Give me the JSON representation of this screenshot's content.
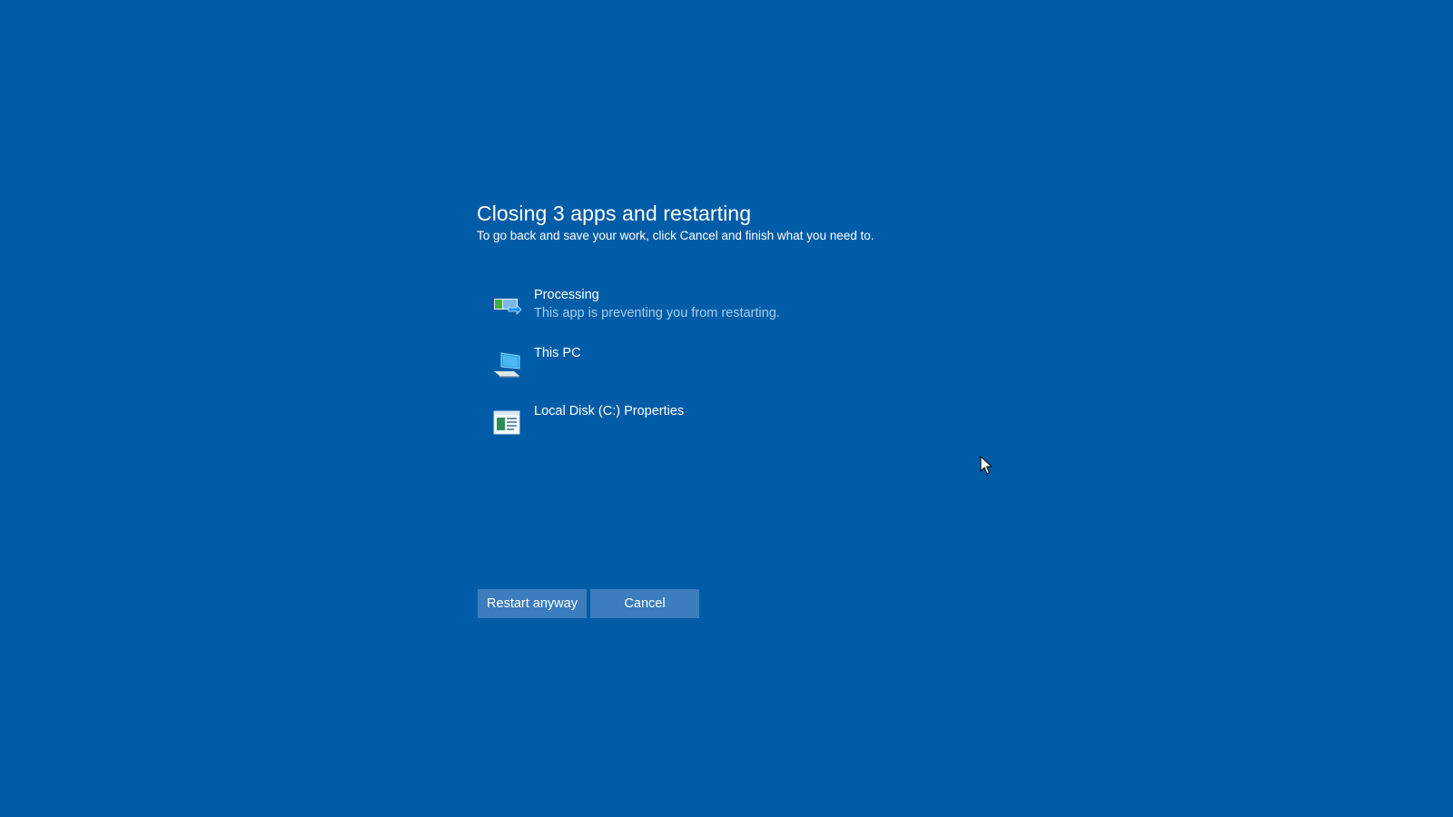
{
  "dialog": {
    "title": "Closing 3 apps and restarting",
    "subtitle": "To go back and save your work, click Cancel and finish what you need to."
  },
  "apps": [
    {
      "name": "Processing",
      "status": "This app is preventing you from restarting.",
      "icon": "processing-app-icon"
    },
    {
      "name": "This PC",
      "status": "",
      "icon": "this-pc-icon"
    },
    {
      "name": "Local Disk (C:) Properties",
      "status": "",
      "icon": "properties-window-icon"
    }
  ],
  "buttons": {
    "restart_label": "Restart anyway",
    "cancel_label": "Cancel"
  },
  "colors": {
    "background": "#005ca6",
    "button": "#3b7dbd",
    "status_text": "#a8cff0",
    "text": "#ffffff"
  }
}
